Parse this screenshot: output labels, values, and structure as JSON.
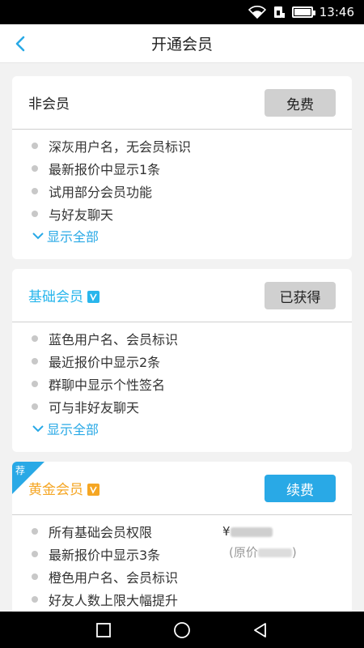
{
  "status_bar": {
    "time": "13:46"
  },
  "nav": {
    "title": "开通会员"
  },
  "plans": [
    {
      "title": "非会员",
      "button": "免费",
      "features": [
        "深灰用户名，无会员标识",
        "最新报价中显示1条",
        "试用部分会员功能",
        "与好友聊天"
      ],
      "show_all": "显示全部"
    },
    {
      "title": "基础会员",
      "button": "已获得",
      "features": [
        "蓝色用户名、会员标识",
        "最近报价中显示2条",
        "群聊中显示个性签名",
        "可与非好友聊天"
      ],
      "show_all": "显示全部"
    },
    {
      "title": "黄金会员",
      "button": "续费",
      "tag": "荐",
      "features": [
        "所有基础会员权限",
        "最新报价中显示3条",
        "橙色用户名、会员标识",
        "好友人数上限大幅提升"
      ],
      "price_prefix": "¥",
      "orig_prefix": "(原价",
      "orig_suffix": ")"
    }
  ],
  "colors": {
    "accent": "#29a9e6",
    "gold": "#f5a623",
    "disabled": "#d0d0d0"
  }
}
